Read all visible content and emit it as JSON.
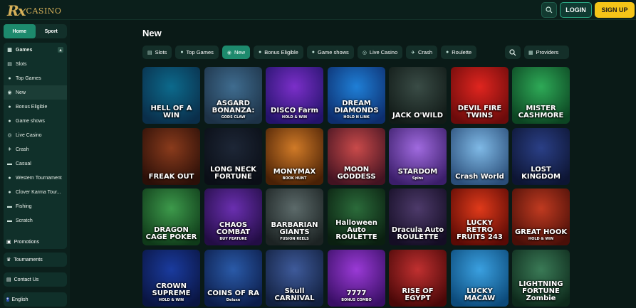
{
  "brand": {
    "mark": "Rx",
    "name": "CASINO"
  },
  "header": {
    "login_label": "LOGIN",
    "signup_label": "SIGN UP"
  },
  "sidebar": {
    "toggle": {
      "home": "Home",
      "sport": "Sport"
    },
    "games_label": "Games",
    "items": [
      {
        "label": "Slots",
        "icon": "slots-icon"
      },
      {
        "label": "Top Games",
        "icon": "top-games-icon"
      },
      {
        "label": "New",
        "icon": "new-icon"
      },
      {
        "label": "Bonus Eligible",
        "icon": "bonus-icon"
      },
      {
        "label": "Game shows",
        "icon": "game-shows-icon"
      },
      {
        "label": "Live Casino",
        "icon": "live-casino-icon"
      },
      {
        "label": "Crash",
        "icon": "crash-icon"
      },
      {
        "label": "Casual",
        "icon": "casual-icon"
      },
      {
        "label": "Western Tournament",
        "icon": "western-icon"
      },
      {
        "label": "Clover Karma Tour...",
        "icon": "clover-icon"
      },
      {
        "label": "Fishing",
        "icon": "fishing-icon"
      },
      {
        "label": "Scratch",
        "icon": "scratch-icon"
      }
    ],
    "promotions": "Promotions",
    "tournaments": "Tournaments",
    "contact": "Contact Us",
    "language": "English"
  },
  "main": {
    "title": "New",
    "tabs": [
      {
        "label": "Slots",
        "icon": "slots-icon",
        "active": false
      },
      {
        "label": "Top Games",
        "icon": "top-games-icon",
        "active": false
      },
      {
        "label": "New",
        "icon": "new-icon",
        "active": true
      },
      {
        "label": "Bonus Eligible",
        "icon": "bonus-icon",
        "active": false
      },
      {
        "label": "Game shows",
        "icon": "game-shows-icon",
        "active": false
      },
      {
        "label": "Live Casino",
        "icon": "live-casino-icon",
        "active": false
      },
      {
        "label": "Crash",
        "icon": "crash-icon",
        "active": false
      },
      {
        "label": "Roulette",
        "icon": "roulette-icon",
        "active": false
      }
    ],
    "providers_label": "Providers"
  },
  "games": [
    {
      "title": "HELL OF A WIN",
      "sub": "",
      "colors": [
        "#0c6a8c",
        "#0a2e4a"
      ]
    },
    {
      "title": "ASGARD BONANZA:",
      "sub": "GODS CLAW",
      "colors": [
        "#3f6c8f",
        "#1d3247"
      ]
    },
    {
      "title": "DISCO Farm",
      "sub": "HOLD & WIN",
      "colors": [
        "#7b2fc9",
        "#24136b"
      ]
    },
    {
      "title": "DREAM DIAMONDS",
      "sub": "HOLD N LINK",
      "colors": [
        "#1f7fd6",
        "#0d2e6e"
      ]
    },
    {
      "title": "JACK O'WILD",
      "sub": "",
      "colors": [
        "#3a4c46",
        "#111a17"
      ]
    },
    {
      "title": "DEVIL FIRE TWINS",
      "sub": "",
      "colors": [
        "#e0251f",
        "#6b0b0b"
      ]
    },
    {
      "title": "MISTER CASHMORE",
      "sub": "",
      "colors": [
        "#2eaa57",
        "#0c4522"
      ]
    },
    {
      "title": "FREAK OUT",
      "sub": "",
      "colors": [
        "#8a3b1c",
        "#2b0f08"
      ]
    },
    {
      "title": "LONG NECK FORTUNE",
      "sub": "",
      "colors": [
        "#1d2636",
        "#0a0e16"
      ]
    },
    {
      "title": "MONYMAX",
      "sub": "BOOK HUNT",
      "colors": [
        "#d07a27",
        "#4a2106"
      ]
    },
    {
      "title": "MOON GODDESS",
      "sub": "",
      "colors": [
        "#c94a4a",
        "#431321"
      ]
    },
    {
      "title": "STARDOM",
      "sub": "Spins",
      "colors": [
        "#a06adf",
        "#3b1e6a"
      ]
    },
    {
      "title": "Crash World",
      "sub": "",
      "colors": [
        "#7fb9e6",
        "#2a4d78"
      ]
    },
    {
      "title": "LOST KINGDOM",
      "sub": "",
      "colors": [
        "#2a3f86",
        "#0d1533"
      ]
    },
    {
      "title": "DRAGON CAGE POKER",
      "sub": "",
      "colors": [
        "#3d9a4b",
        "#0f3a19"
      ]
    },
    {
      "title": "CHAOS COMBAT",
      "sub": "BUY FEATURE",
      "colors": [
        "#6a2fb0",
        "#230d45"
      ]
    },
    {
      "title": "BARBARIAN GIANTS",
      "sub": "FUSION REELS",
      "colors": [
        "#5c6a6a",
        "#1c2323"
      ]
    },
    {
      "title": "Halloween Auto ROULETTE",
      "sub": "",
      "colors": [
        "#2b6b3a",
        "#0a1f10"
      ]
    },
    {
      "title": "Dracula Auto ROULETTE",
      "sub": "",
      "colors": [
        "#4d3a6a",
        "#140d24"
      ]
    },
    {
      "title": "LUCKY RETRO FRUITS 243",
      "sub": "",
      "colors": [
        "#e03a1a",
        "#5a0a05"
      ]
    },
    {
      "title": "GREAT HOOK",
      "sub": "HOLD & WIN",
      "colors": [
        "#c03a20",
        "#4a0f08"
      ]
    },
    {
      "title": "CROWN SUPREME",
      "sub": "HOLD & WIN",
      "colors": [
        "#1a3b9e",
        "#0a1542"
      ]
    },
    {
      "title": "COINS OF RA",
      "sub": "Deluxe",
      "colors": [
        "#2a5aa8",
        "#0c1d4a"
      ]
    },
    {
      "title": "Skull CARNIVAL",
      "sub": "",
      "colors": [
        "#3e5a9a",
        "#12203f"
      ]
    },
    {
      "title": "7777",
      "sub": "BONUS COMBO",
      "colors": [
        "#9a3ad6",
        "#3a0f66"
      ]
    },
    {
      "title": "RISE OF EGYPT",
      "sub": "",
      "colors": [
        "#c03030",
        "#4a0808"
      ]
    },
    {
      "title": "LUCKY MACAW",
      "sub": "",
      "colors": [
        "#3aa0e0",
        "#0c4a7a"
      ]
    },
    {
      "title": "LIGHTNING FORTUNE Zombie",
      "sub": "",
      "colors": [
        "#3a7a56",
        "#0e2a1c"
      ]
    }
  ]
}
